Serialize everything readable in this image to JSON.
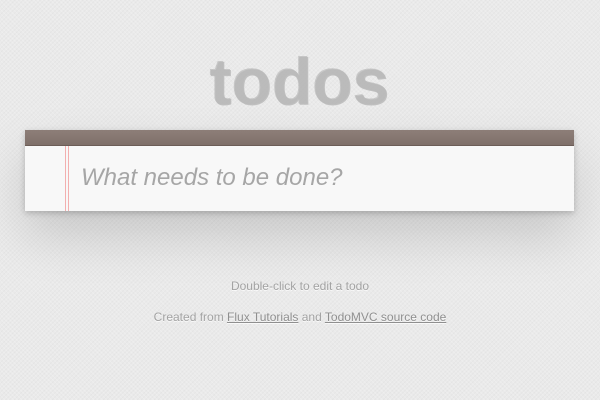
{
  "header": {
    "title": "todos"
  },
  "new_todo": {
    "placeholder": "What needs to be done?",
    "value": ""
  },
  "footer_info": {
    "hint": "Double-click to edit a todo",
    "credits_prefix": "Created from",
    "link1_text": "Flux Tutorials",
    "credits_middle": "and",
    "link2_text": "TodoMVC source code"
  },
  "colors": {
    "background": "#eaeaea",
    "title": "#b9b9b9",
    "header_bar": "#8d7e78",
    "card": "#f8f8f8",
    "margin_line": "#f2a6a6",
    "placeholder": "#a6a6a6",
    "info_text": "#a3a3a3"
  }
}
